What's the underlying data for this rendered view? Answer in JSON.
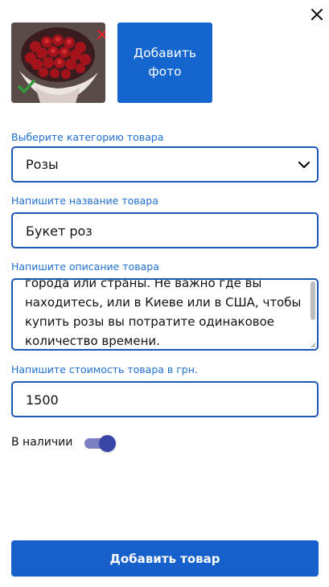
{
  "photos": {
    "thumbnail": {
      "icon_selected": "check-icon",
      "icon_remove": "close-icon"
    },
    "add_label": "Добавить фото"
  },
  "form": {
    "category": {
      "label": "Выберите категорию товара",
      "value": "Розы"
    },
    "name": {
      "label": "Напишите название товара",
      "value": "Букет роз"
    },
    "description": {
      "label": "Напишите описание товара",
      "value": "города или страны. Не важно где вы\nнаходитесь, или в Киеве или в США, чтобы\nкупить розы вы потратите одинаковое\nколичество времени."
    },
    "price": {
      "label": "Напишите стоимость товара в грн.",
      "value": "1500"
    },
    "availability": {
      "label": "В наличии",
      "enabled": true
    }
  },
  "submit_label": "Добавить товар",
  "colors": {
    "accent": "#1565cf",
    "border": "#1b57b5",
    "label": "#1f6fcf",
    "toggle": "#3a45a8"
  }
}
